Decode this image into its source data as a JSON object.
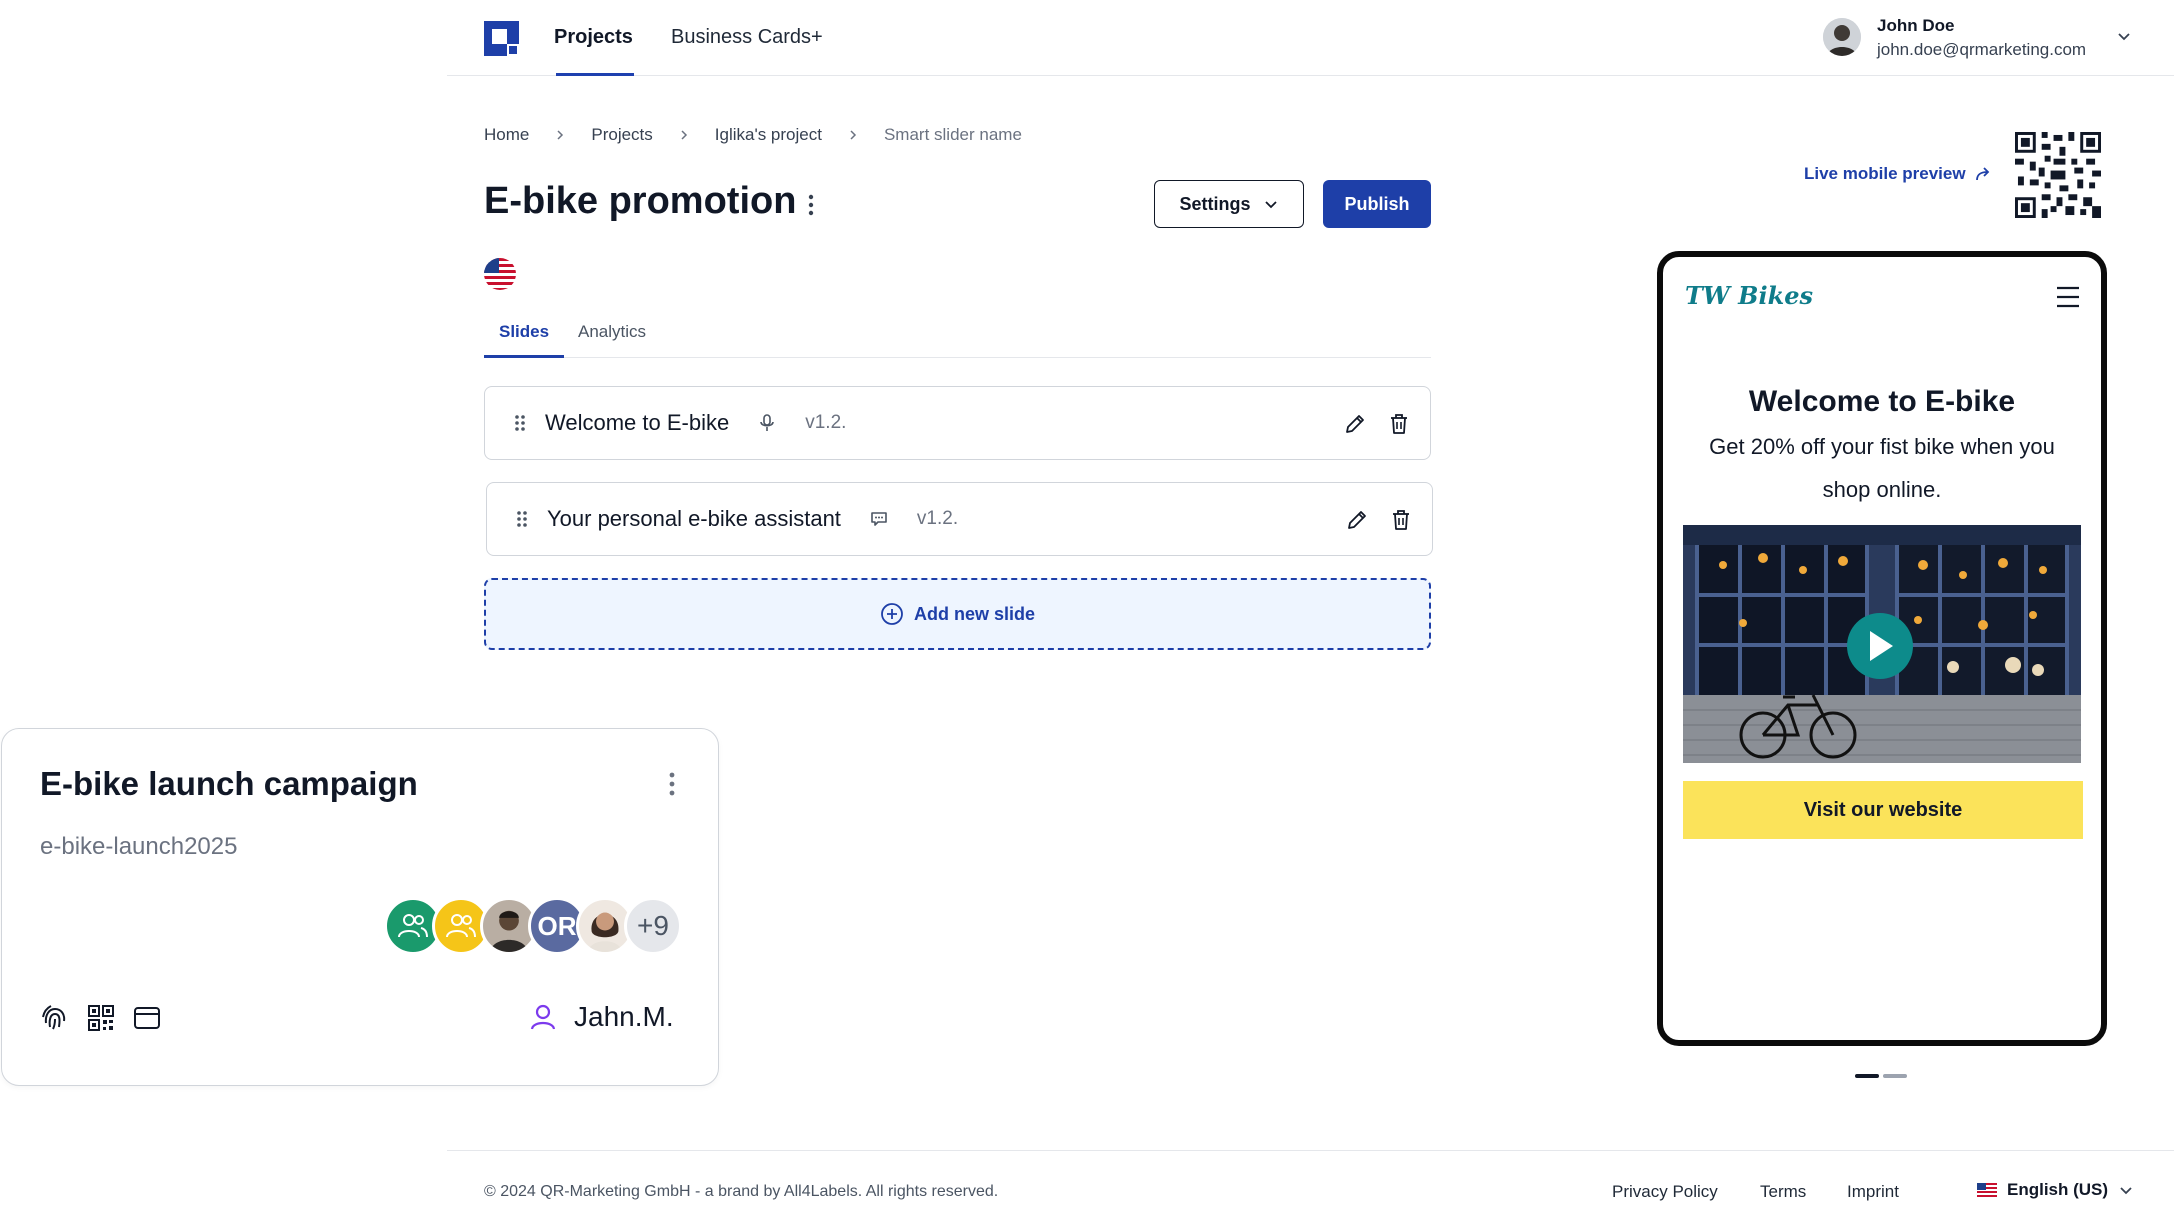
{
  "topnav": {
    "tabs": [
      {
        "label": "Projects",
        "active": true
      },
      {
        "label": "Business Cards+",
        "active": false
      }
    ],
    "user": {
      "name": "John Doe",
      "email": "john.doe@qrmarketing.com"
    }
  },
  "breadcrumb": [
    "Home",
    "Projects",
    "Iglika's project",
    "Smart slider name"
  ],
  "page": {
    "title": "E-bike promotion",
    "settings_label": "Settings",
    "publish_label": "Publish",
    "language_flag": "us-flag-icon"
  },
  "tabs": [
    {
      "label": "Slides",
      "active": true
    },
    {
      "label": "Analytics",
      "active": false
    }
  ],
  "slides": [
    {
      "title": "Welcome to E-bike",
      "type_icon": "microphone-icon",
      "version": "v1.2."
    },
    {
      "title": "Your personal e-bike assistant",
      "type_icon": "chat-icon",
      "version": "v1.2."
    }
  ],
  "add_slide_label": "Add new slide",
  "preview": {
    "live_label": "Live mobile preview",
    "brand": "TW Bikes",
    "heading": "Welcome to E-bike",
    "subtext": "Get 20% off your fist bike when you shop online.",
    "cta": "Visit our website",
    "pager": {
      "count": 2,
      "active_index": 0
    }
  },
  "campaign_card": {
    "title": "E-bike launch campaign",
    "slug": "e-bike-launch2025",
    "avatars": [
      {
        "kind": "group-icon",
        "color": "#1a9a6c"
      },
      {
        "kind": "group-icon",
        "color": "#f5c518"
      },
      {
        "kind": "photo",
        "color": "#5b4636"
      },
      {
        "kind": "initials",
        "text": "OR",
        "color": "#5a6aa0"
      },
      {
        "kind": "photo",
        "color": "#8a6a55"
      }
    ],
    "more_count": "+9",
    "owner": "Jahn.M."
  },
  "footer": {
    "copyright": "© 2024 QR-Marketing GmbH - a brand by All4Labels. All rights reserved.",
    "links": [
      "Privacy Policy",
      "Terms",
      "Imprint"
    ],
    "language": "English (US)"
  },
  "colors": {
    "accent": "#1e3fa8",
    "cta_yellow": "#fbe35a",
    "brand_teal": "#0f7c8a",
    "add_slide_bg": "#eef5ff"
  }
}
